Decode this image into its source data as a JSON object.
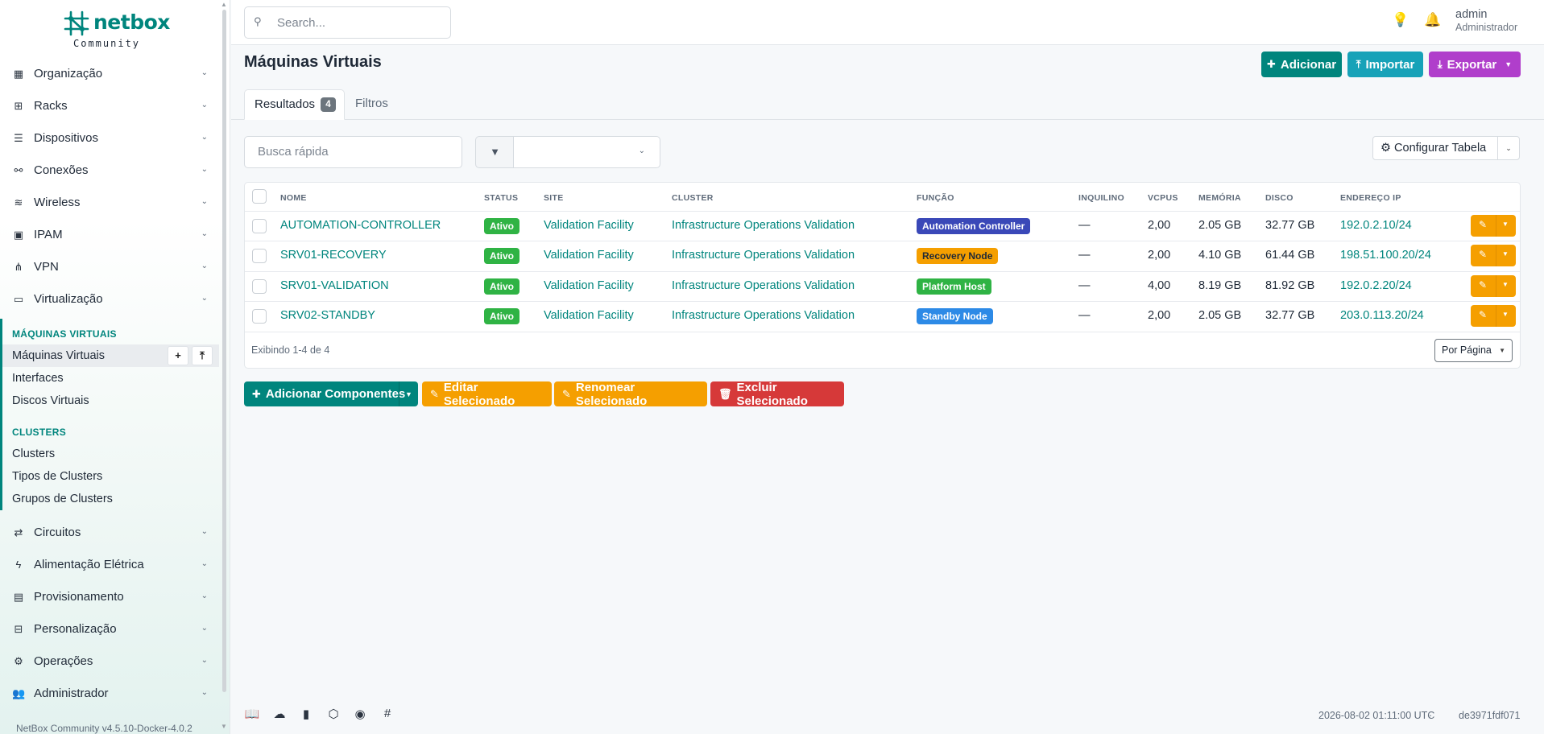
{
  "logo": {
    "brand": "netbox",
    "edition": "Community"
  },
  "sidebar": {
    "items_top": [
      {
        "label": "Organização",
        "icon": "organization-icon"
      },
      {
        "label": "Racks",
        "icon": "rack-icon"
      },
      {
        "label": "Dispositivos",
        "icon": "device-icon"
      },
      {
        "label": "Conexões",
        "icon": "connections-icon"
      },
      {
        "label": "Wireless",
        "icon": "wifi-icon"
      },
      {
        "label": "IPAM",
        "icon": "ipam-icon"
      },
      {
        "label": "VPN",
        "icon": "vpn-icon"
      },
      {
        "label": "Virtualização",
        "icon": "monitor-icon"
      }
    ],
    "submenu": {
      "group1": "MÁQUINAS VIRTUAIS",
      "group1_links": [
        "Máquinas Virtuais",
        "Interfaces",
        "Discos Virtuais"
      ],
      "group2": "CLUSTERS",
      "group2_links": [
        "Clusters",
        "Tipos de Clusters",
        "Grupos de Clusters"
      ]
    },
    "items_bottom": [
      {
        "label": "Circuitos",
        "icon": "circuits-icon"
      },
      {
        "label": "Alimentação Elétrica",
        "icon": "power-icon"
      },
      {
        "label": "Provisionamento",
        "icon": "provisioning-icon"
      },
      {
        "label": "Personalização",
        "icon": "customization-icon"
      },
      {
        "label": "Operações",
        "icon": "operations-icon"
      },
      {
        "label": "Administrador",
        "icon": "admin-icon"
      }
    ],
    "version": "NetBox Community v4.5.10-Docker-4.0.2"
  },
  "header": {
    "search_placeholder": "Search...",
    "user_name": "admin",
    "user_role": "Administrador"
  },
  "page": {
    "title": "Máquinas Virtuais",
    "add_label": "Adicionar",
    "import_label": "Importar",
    "export_label": "Exportar",
    "tab_results": "Resultados",
    "tab_results_count": "4",
    "tab_filters": "Filtros",
    "quick_search_placeholder": "Busca rápida",
    "configure_table": "Configurar Tabela"
  },
  "table": {
    "columns": [
      "NOME",
      "STATUS",
      "SITE",
      "CLUSTER",
      "FUNÇÃO",
      "INQUILINO",
      "VCPUS",
      "MEMÓRIA",
      "DISCO",
      "ENDEREÇO IP"
    ],
    "rows": [
      {
        "name": "AUTOMATION-CONTROLLER",
        "status": "Ativo",
        "site": "Validation Facility",
        "cluster": "Infrastructure Operations Validation",
        "role": "Automation Controller",
        "role_color": "#3a48b8",
        "role_text": "#ffffff",
        "tenant": "—",
        "vcpus": "2,00",
        "memory": "2.05 GB",
        "disk": "32.77 GB",
        "ip": "192.0.2.10/24"
      },
      {
        "name": "SRV01-RECOVERY",
        "status": "Ativo",
        "site": "Validation Facility",
        "cluster": "Infrastructure Operations Validation",
        "role": "Recovery Node",
        "role_color": "#f59f00",
        "role_text": "#1f2937",
        "tenant": "—",
        "vcpus": "2,00",
        "memory": "4.10 GB",
        "disk": "61.44 GB",
        "ip": "198.51.100.20/24"
      },
      {
        "name": "SRV01-VALIDATION",
        "status": "Ativo",
        "site": "Validation Facility",
        "cluster": "Infrastructure Operations Validation",
        "role": "Platform Host",
        "role_color": "#2fb344",
        "role_text": "#ffffff",
        "tenant": "—",
        "vcpus": "4,00",
        "memory": "8.19 GB",
        "disk": "81.92 GB",
        "ip": "192.0.2.20/24"
      },
      {
        "name": "SRV02-STANDBY",
        "status": "Ativo",
        "site": "Validation Facility",
        "cluster": "Infrastructure Operations Validation",
        "role": "Standby Node",
        "role_color": "#2d8ae6",
        "role_text": "#ffffff",
        "tenant": "—",
        "vcpus": "2,00",
        "memory": "2.05 GB",
        "disk": "32.77 GB",
        "ip": "203.0.113.20/24"
      }
    ],
    "showing": "Exibindo 1-4 de 4",
    "per_page": "Por Página"
  },
  "bulk": {
    "add_components": "Adicionar Componentes",
    "edit_selected": "Editar Selecionado",
    "rename_selected": "Renomear Selecionado",
    "delete_selected": "Excluir Selecionado"
  },
  "footer": {
    "timestamp": "2026-08-02 01:11:00 UTC",
    "separator": "·",
    "commit": "de3971fdf071"
  }
}
